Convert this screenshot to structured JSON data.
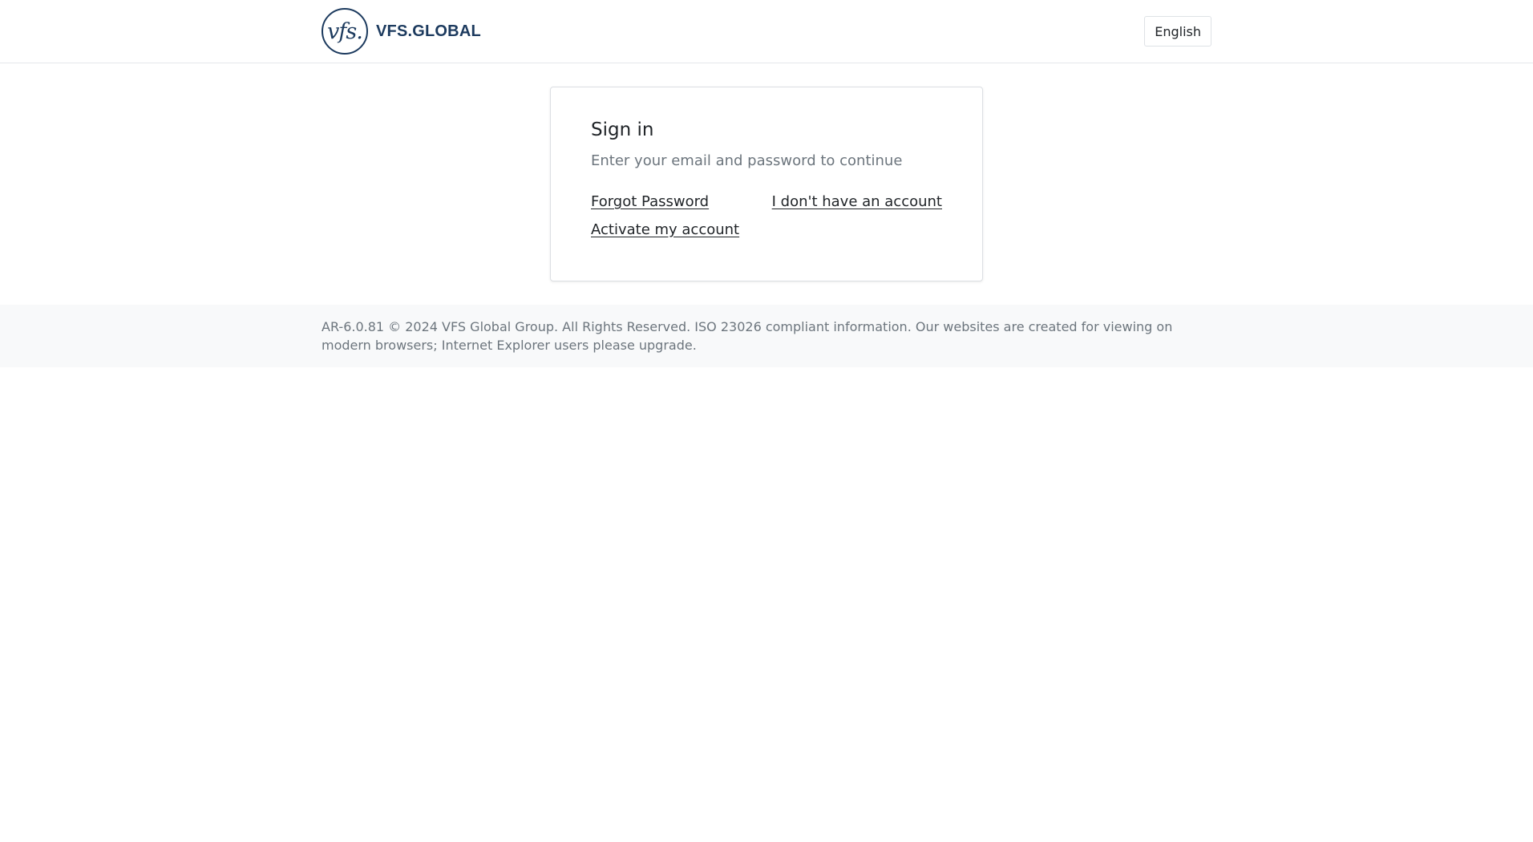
{
  "header": {
    "logo_mark": "vfs.",
    "logo_text": "VFS.GLOBAL",
    "language_button": "English"
  },
  "signin": {
    "title": "Sign in",
    "subtitle": "Enter your email and password to continue",
    "forgot_password": "Forgot Password",
    "no_account": "I don't have an account",
    "activate_account": "Activate my account"
  },
  "footer": {
    "text": "AR-6.0.81 © 2024 VFS Global Group. All Rights Reserved. ISO 23026 compliant information. Our websites are created for viewing on modern browsers; Internet Explorer users please upgrade."
  },
  "colors": {
    "brand": "#1c3a5e",
    "muted_text": "#6c757d",
    "footer_bg": "#f8f9fa"
  }
}
